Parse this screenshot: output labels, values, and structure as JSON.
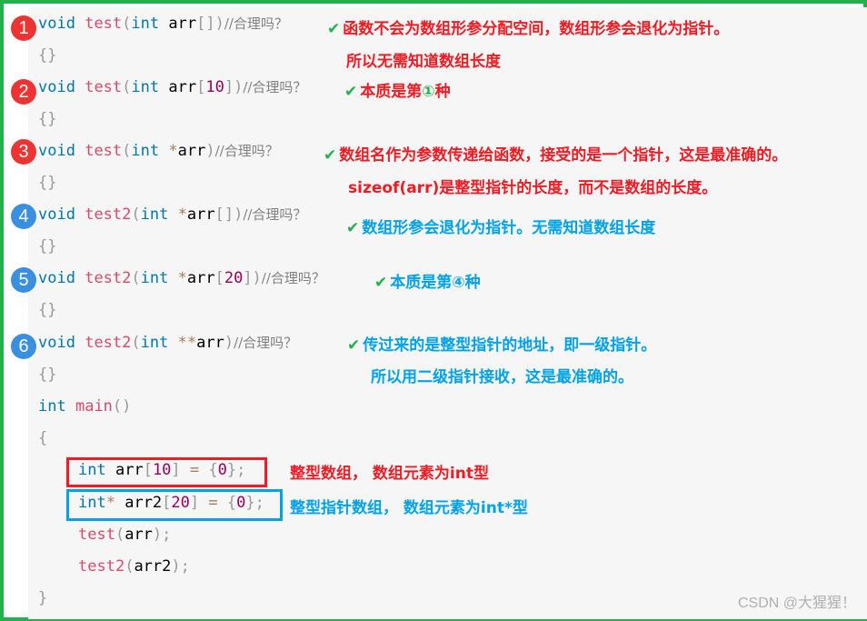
{
  "code": {
    "comment": "//合理吗？",
    "lines": [
      {
        "kw": "void",
        "fn": "test",
        "p1": "(",
        "type": "int",
        "ptr": "",
        "name": "arr",
        "suffix": "[]",
        "num": "",
        "close": ")"
      },
      {
        "kw": "void",
        "fn": "test",
        "p1": "(",
        "type": "int",
        "ptr": "",
        "name": "arr",
        "suffix": "[",
        "num": "10",
        "close": "])"
      },
      {
        "kw": "void",
        "fn": "test",
        "p1": "(",
        "type": "int",
        "ptr": "*",
        "name": "arr",
        "suffix": "",
        "num": "",
        "close": ")"
      },
      {
        "kw": "void",
        "fn": "test2",
        "p1": "(",
        "type": "int",
        "ptr": "*",
        "name": "arr",
        "suffix": "[]",
        "num": "",
        "close": ")"
      },
      {
        "kw": "void",
        "fn": "test2",
        "p1": "(",
        "type": "int",
        "ptr": "*",
        "name": "arr",
        "suffix": "[",
        "num": "20",
        "close": "])"
      },
      {
        "kw": "void",
        "fn": "test2",
        "p1": "(",
        "type": "int",
        "ptr": "**",
        "name": "arr",
        "suffix": "",
        "num": "",
        "close": ")"
      }
    ],
    "braces": "{}",
    "main_type": "int",
    "main_fn": "main",
    "main_parens": "()",
    "open_brace": "{",
    "close_brace": "}",
    "decl1": {
      "type": "int",
      "name": "arr",
      "lb": "[",
      "num": "10",
      "rb": "]",
      "eq": "=",
      "init_open": "{",
      "init_val": "0",
      "init_close": "};"
    },
    "decl2": {
      "type": "int",
      "ptr": "*",
      "name": "arr2",
      "lb": "[",
      "num": "20",
      "rb": "]",
      "eq": "=",
      "init_open": "{",
      "init_val": "0",
      "init_close": "};"
    },
    "call1": {
      "fn": "test",
      "open": "(",
      "arg": "arr",
      "close": ");"
    },
    "call2": {
      "fn": "test2",
      "open": "(",
      "arg": "arr2",
      "close": ");"
    }
  },
  "badges": [
    "1",
    "2",
    "3",
    "4",
    "5",
    "6"
  ],
  "notes": {
    "check": "✔",
    "n1_line1": "函数不会为数组形参分配空间，数组形参会退化为指针。",
    "n1_line2": "所以无需知道数组长度",
    "n2_pre": "本质是第",
    "n2_circ": "①",
    "n2_post": "种",
    "n3_line1": "数组名作为参数传递给函数，接受的是一个指针，这是最准确的。",
    "n3_line2": "sizeof(arr)是整型指针的长度，而不是数组的长度。",
    "n4": "数组形参会退化为指针。无需知道数组长度",
    "n5_pre": "本质是第",
    "n5_circ": "④",
    "n5_post": "种",
    "n6_line1": "传过来的是整型指针的地址，即一级指针。",
    "n6_line2": "所以用二级指针接收，这是最准确的。",
    "decl1": "整型数组， 数组元素为int型",
    "decl2": "整型指针数组， 数组元素为int*型"
  },
  "colors": {
    "frame": "#22b14c",
    "note_red": "#ee1c24",
    "note_blue": "#00a2e8"
  },
  "watermark": "CSDN @大猩猩！"
}
